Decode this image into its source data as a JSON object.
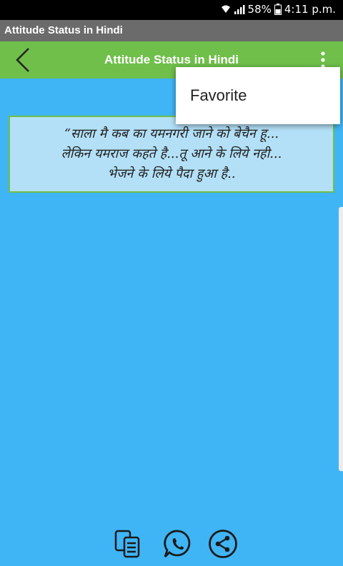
{
  "status_bar": {
    "battery": "58%",
    "time": "4:11 p.m."
  },
  "window_title": "Attitude Status in Hindi",
  "app_bar": {
    "title": "Attitude Status in Hindi",
    "back_icon": "back-chevron-icon",
    "more_icon": "more-vert-icon"
  },
  "menu": {
    "items": [
      {
        "label": "Favorite"
      }
    ]
  },
  "quote": {
    "text": "“साला मै कब का यमनगरी जाने को बेचैन हू...\nलेकिन यमराज कहते है...तू आने के लिये नही...\nभेजने के लिये पैदा हुआ है.."
  },
  "actions": {
    "copy_icon": "copy-icon",
    "whatsapp_icon": "whatsapp-icon",
    "share_icon": "share-icon"
  },
  "colors": {
    "app_bar": "#6fbf4a",
    "background": "#3fb5f5",
    "card": "#b3e0f7"
  }
}
